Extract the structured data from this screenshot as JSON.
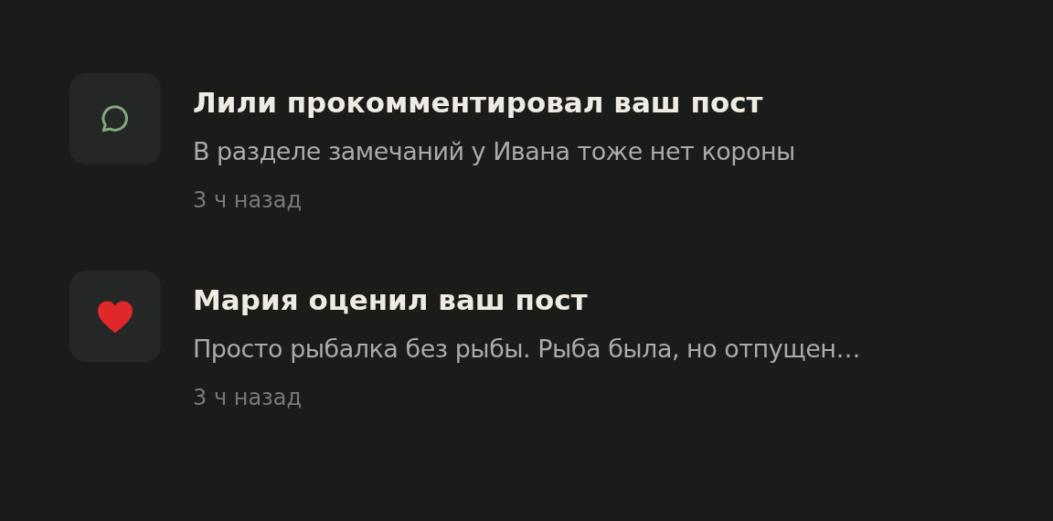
{
  "notifications": [
    {
      "kind": "comment",
      "title": "Лили прокомментировал ваш пост",
      "text": "В разделе замечаний у Ивана тоже нет короны",
      "time": "3 ч назад"
    },
    {
      "kind": "like",
      "title": "Мария оценил ваш пост",
      "text": "Просто рыбалка без рыбы. Рыба была, но отпущен…",
      "time": "3 ч назад"
    }
  ]
}
